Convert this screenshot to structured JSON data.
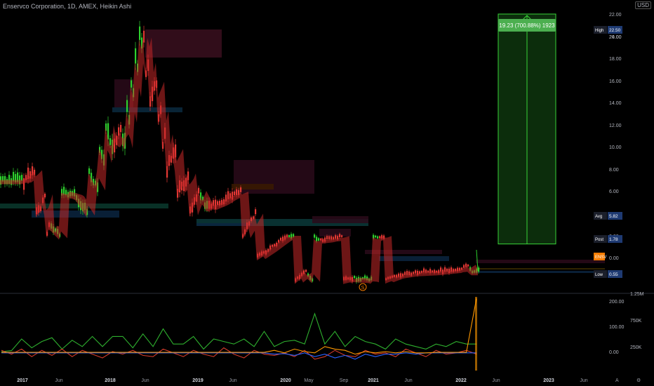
{
  "header": {
    "title": "Enservco Corporation, 1D, AMEX, Heikin Ashi",
    "currency": "USD"
  },
  "colors": {
    "background": "#000000",
    "up": "#2ed12e",
    "down": "#e53935",
    "ribbon": "#c62828",
    "target_box": "#0c2d0c",
    "target_line": "#39d439",
    "badge_green": "#4caf50",
    "label_blue": "#1e3a72",
    "ticker_orange": "#f57c00",
    "osc_green": "#2eaf2e",
    "osc_red": "#d23a2a",
    "osc_blue": "#2962ff",
    "osc_orange": "#ff9800"
  },
  "chart_data": [
    {
      "type": "candlestick",
      "chart_style": "Heikin Ashi",
      "title": "Enservco Corporation, 1D, AMEX, Heikin Ashi",
      "price_axis": {
        "ticks": [
          "24.00",
          "22.00",
          "20.00",
          "18.00",
          "16.00",
          "14.00",
          "12.00",
          "10.00",
          "8.00",
          "6.00",
          "4.00",
          "2.00",
          "0.00"
        ],
        "tick_values": [
          24,
          22,
          20,
          18,
          16,
          14,
          12,
          10,
          8,
          6,
          4,
          2,
          0
        ],
        "scale": "non-linear (compressed near zero)"
      },
      "time_axis": {
        "labels": [
          "2017",
          "Jun",
          "2018",
          "Jun",
          "2019",
          "Jun",
          "2020",
          "May",
          "Sep",
          "2021",
          "Jun",
          "2022",
          "Jun",
          "2023",
          "Jun"
        ],
        "bold": [
          "2017",
          "2018",
          "2019",
          "2020",
          "2021",
          "2022",
          "2023"
        ]
      },
      "price_path": [
        {
          "t": 2017.0,
          "p": 9.0
        },
        {
          "t": 2017.08,
          "p": 8.5
        },
        {
          "t": 2017.2,
          "p": 7.5
        },
        {
          "t": 2017.3,
          "p": 5.0
        },
        {
          "t": 2017.42,
          "p": 6.0
        },
        {
          "t": 2017.6,
          "p": 6.4
        },
        {
          "t": 2017.75,
          "p": 8.2
        },
        {
          "t": 2017.9,
          "p": 10.5
        },
        {
          "t": 2018.0,
          "p": 14.0
        },
        {
          "t": 2018.12,
          "p": 12.5
        },
        {
          "t": 2018.25,
          "p": 17.0
        },
        {
          "t": 2018.35,
          "p": 21.0
        },
        {
          "t": 2018.45,
          "p": 17.5
        },
        {
          "t": 2018.55,
          "p": 15.5
        },
        {
          "t": 2018.65,
          "p": 11.5
        },
        {
          "t": 2018.75,
          "p": 10.0
        },
        {
          "t": 2018.85,
          "p": 9.0
        },
        {
          "t": 2019.0,
          "p": 6.0
        },
        {
          "t": 2019.1,
          "p": 7.5
        },
        {
          "t": 2019.25,
          "p": 7.0
        },
        {
          "t": 2019.35,
          "p": 6.5
        },
        {
          "t": 2019.5,
          "p": 6.0
        },
        {
          "t": 2019.65,
          "p": 4.0
        },
        {
          "t": 2019.8,
          "p": 3.2
        },
        {
          "t": 2020.0,
          "p": 2.0
        },
        {
          "t": 2020.1,
          "p": 2.0
        },
        {
          "t": 2020.22,
          "p": 1.2
        },
        {
          "t": 2020.35,
          "p": 2.4
        },
        {
          "t": 2020.55,
          "p": 2.2
        },
        {
          "t": 2020.75,
          "p": 1.8
        },
        {
          "t": 2020.95,
          "p": 1.9
        },
        {
          "t": 2021.05,
          "p": 2.2
        },
        {
          "t": 2021.25,
          "p": 1.6
        },
        {
          "t": 2021.5,
          "p": 1.3
        },
        {
          "t": 2021.75,
          "p": 1.2
        },
        {
          "t": 2022.0,
          "p": 1.0
        },
        {
          "t": 2022.08,
          "p": 0.6
        },
        {
          "t": 2022.1,
          "p": 1.2
        }
      ],
      "price_labels": [
        {
          "name": "High",
          "value": "22.50"
        },
        {
          "name": "Avg",
          "value": "5.82"
        },
        {
          "name": "Post",
          "value": "1.78"
        },
        {
          "name": "ENSV",
          "value": ""
        },
        {
          "name": "Low",
          "value": "0.55"
        }
      ],
      "target_measure": {
        "label": "19.23 (700.88%) 1923",
        "from_price": 2.75,
        "to_price": 22.0
      },
      "event_marker": "S"
    },
    {
      "type": "line",
      "title": "",
      "left_axis": {
        "ticks": [
          "200.00",
          "100.00",
          "0.00"
        ],
        "values": [
          200,
          100,
          0
        ]
      },
      "right_axis": {
        "ticks": [
          "1.25M",
          "750K",
          "250K"
        ],
        "values": [
          1250000,
          750000,
          250000
        ]
      },
      "series": [
        {
          "color": "#2eaf2e",
          "values": [
            0,
            4,
            50,
            15,
            40,
            55,
            10,
            45,
            20,
            60,
            20,
            60,
            60,
            15,
            70,
            20,
            90,
            30,
            30,
            60,
            10,
            50,
            40,
            30,
            50,
            20,
            80,
            20,
            40,
            45,
            30,
            150,
            30,
            80,
            20,
            60,
            40,
            30,
            10,
            50,
            30,
            20,
            10,
            30,
            20,
            40,
            30,
            30
          ]
        },
        {
          "color": "#d23a2a",
          "values": [
            5,
            -10,
            10,
            -20,
            5,
            -15,
            10,
            -20,
            5,
            -10,
            -25,
            0,
            -10,
            5,
            -15,
            -20,
            10,
            -5,
            -20,
            5,
            -10,
            -20,
            15,
            -10,
            -25,
            5,
            -10,
            -15,
            -5,
            -20,
            5,
            -30,
            -20,
            5,
            -15,
            -20,
            5,
            -10,
            -5,
            -20,
            10,
            -5,
            -20,
            5,
            -10,
            -5,
            5,
            -10
          ]
        },
        {
          "color": "#2962ff",
          "values": [
            -5,
            -5,
            -5,
            -5,
            -5,
            -5,
            -5,
            -5,
            -5,
            -5,
            -5,
            -5,
            -5,
            -5,
            -5,
            -5,
            -5,
            -5,
            -5,
            -5,
            -5,
            -5,
            -5,
            -5,
            -5,
            -5,
            -5,
            -10,
            -8,
            -15,
            -5,
            -20,
            -10,
            -25,
            -15,
            -30,
            -10,
            -20,
            -10,
            -10,
            -5,
            -10,
            -5,
            -5,
            -5,
            -5,
            -5,
            -5
          ]
        },
        {
          "color": "#ff9800",
          "values": [
            -3,
            -3,
            -3,
            -3,
            -3,
            -3,
            -3,
            -3,
            -3,
            -3,
            -3,
            -3,
            -3,
            -3,
            -3,
            -3,
            -3,
            -3,
            -3,
            -3,
            -3,
            -3,
            -3,
            -3,
            -3,
            -3,
            -3,
            5,
            -5,
            10,
            0,
            -5,
            20,
            10,
            5,
            -10,
            0,
            -5,
            0,
            -5,
            0,
            -5,
            -5,
            -3,
            -3,
            -3,
            -3,
            210
          ]
        }
      ]
    }
  ]
}
